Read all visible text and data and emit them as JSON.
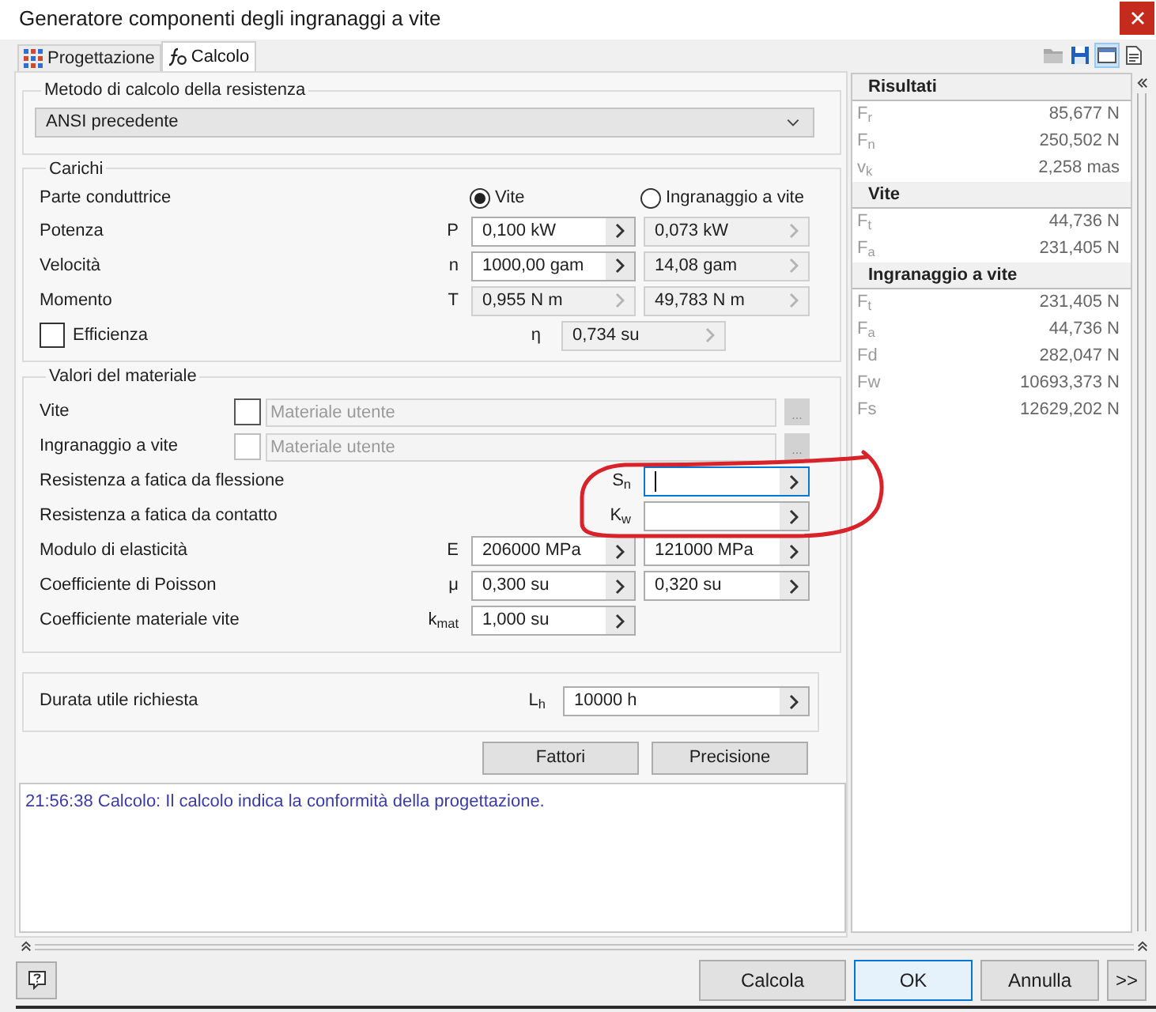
{
  "window": {
    "title": "Generatore componenti degli ingranaggi a vite"
  },
  "tabs": [
    {
      "label": "Progettazione",
      "kind": "design",
      "selected": false
    },
    {
      "label": "Calcolo",
      "kind": "calc",
      "selected": true
    }
  ],
  "toolbar": [
    {
      "kind": "folder",
      "on": false
    },
    {
      "kind": "save",
      "on": false
    },
    {
      "kind": "window",
      "on": true
    },
    {
      "kind": "print",
      "on": false
    }
  ],
  "strength_method": {
    "title": "Metodo di calcolo della resistenza",
    "value": "ANSI precedente"
  },
  "loads": {
    "title": "Carichi",
    "driver": {
      "label": "Parte conduttrice",
      "options": [
        {
          "label": "Vite",
          "selected": true
        },
        {
          "label": "Ingranaggio a vite",
          "selected": false
        }
      ]
    },
    "rows": [
      {
        "label": "Potenza",
        "symbol": "P",
        "fields": [
          {
            "value": "0,100 kW",
            "disabled": false
          },
          {
            "value": "0,073 kW",
            "disabled": true
          }
        ]
      },
      {
        "label": "Velocità",
        "symbol": "n",
        "fields": [
          {
            "value": "1000,00 gam",
            "disabled": false
          },
          {
            "value": "14,08 gam",
            "disabled": true
          }
        ]
      },
      {
        "label": "Momento",
        "symbol": "T",
        "fields": [
          {
            "value": "0,955 N m",
            "disabled": true
          },
          {
            "value": "49,783 N m",
            "disabled": true
          }
        ]
      }
    ],
    "efficiency": {
      "label": "Efficienza",
      "checked": false,
      "symbol": "η",
      "value": "0,734 su",
      "disabled": true
    }
  },
  "material": {
    "title": "Valori del materiale",
    "materials": [
      {
        "label": "Vite",
        "checked": false,
        "disabled": false,
        "placeholder": "Materiale utente",
        "browse": "..."
      },
      {
        "label": "Ingranaggio a vite",
        "checked": false,
        "disabled": true,
        "placeholder": "Materiale utente",
        "browse": "..."
      }
    ],
    "rows": [
      {
        "kind": "right",
        "label": "Resistenza a fatica da flessione",
        "symbol": "S$_{n}$",
        "fields": [
          {
            "disabled": false,
            "focused": true
          }
        ]
      },
      {
        "kind": "right",
        "label": "Resistenza a fatica da contatto",
        "symbol": "K$_{w}$",
        "fields": [
          {
            "disabled": false,
            "focused": false
          }
        ]
      },
      {
        "kind": "pair",
        "label": "Modulo di elasticità",
        "symbol": "E",
        "fields": [
          {
            "value": "206000 MPa",
            "disabled": false,
            "focused": false
          },
          {
            "value": "121000 MPa",
            "disabled": false,
            "focused": false
          }
        ]
      },
      {
        "kind": "pair",
        "label": "Coefficiente di Poisson",
        "symbol": "μ",
        "fields": [
          {
            "value": "0,300 su",
            "disabled": false,
            "focused": false
          },
          {
            "value": "0,320 su",
            "disabled": false,
            "focused": false
          }
        ]
      },
      {
        "kind": "left",
        "label": "Coefficiente materiale vite",
        "symbol": "k$_{mat}$",
        "fields": [
          {
            "value": "1,000 su",
            "disabled": false,
            "focused": false
          }
        ]
      }
    ]
  },
  "life": {
    "label": "Durata utile richiesta",
    "symbol": "L$_{h}$",
    "value": "10000 h",
    "disabled": false
  },
  "actions": [
    "Fattori",
    "Precisione"
  ],
  "log": [
    "21:56:38 Calcolo: Il calcolo indica la conformità della progettazione."
  ],
  "results": [
    {
      "title": "Risultati",
      "rows": [
        {
          "label": "F$_{r}$",
          "value": "85,677 N"
        },
        {
          "label": "F$_{n}$",
          "value": "250,502 N"
        },
        {
          "label": "v$_{k}$",
          "value": "2,258 mas"
        }
      ]
    },
    {
      "title": "Vite",
      "rows": [
        {
          "label": "F$_{t}$",
          "value": "44,736 N"
        },
        {
          "label": "F$_{a}$",
          "value": "231,405 N"
        }
      ]
    },
    {
      "title": "Ingranaggio a vite",
      "rows": [
        {
          "label": "F$_{t}$",
          "value": "231,405 N"
        },
        {
          "label": "F$_{a}$",
          "value": "44,736 N"
        },
        {
          "label": "Fd",
          "value": "282,047 N"
        },
        {
          "label": "Fw",
          "value": "10693,373 N"
        },
        {
          "label": "Fs",
          "value": "12629,202 N"
        }
      ]
    }
  ],
  "footer": {
    "buttons": [
      {
        "label": "Calcola",
        "default": false
      },
      {
        "label": "OK",
        "default": true
      },
      {
        "label": "Annulla",
        "default": false
      },
      {
        "label": ">>",
        "default": false
      }
    ]
  },
  "annotations": [
    {
      "kind": "loop"
    }
  ]
}
